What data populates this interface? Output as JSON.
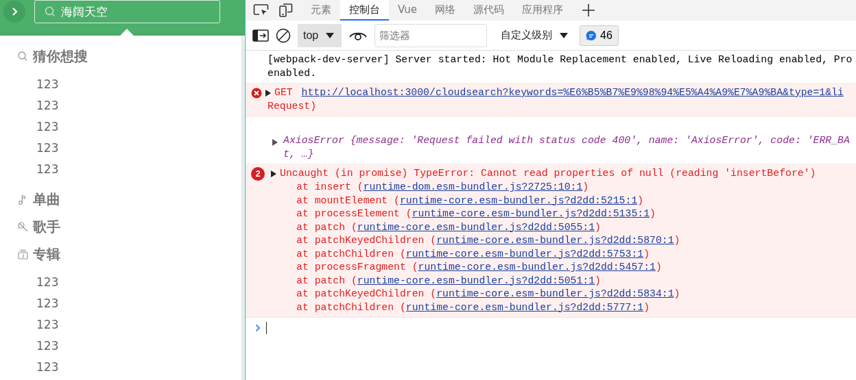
{
  "app": {
    "search": {
      "value": "海阔天空"
    },
    "suggestions": [
      {
        "kind": "search",
        "title": "猜你想搜",
        "items": [
          "123",
          "123",
          "123",
          "123",
          "123"
        ]
      },
      {
        "kind": "song",
        "title": "单曲"
      },
      {
        "kind": "singer",
        "title": "歌手"
      },
      {
        "kind": "album",
        "title": "专辑",
        "items": [
          "123",
          "123",
          "123",
          "123",
          "123"
        ]
      }
    ]
  },
  "devtools": {
    "tabs": [
      {
        "label": "元素",
        "selected": false
      },
      {
        "label": "控制台",
        "selected": true
      },
      {
        "label": "Vue",
        "selected": false
      },
      {
        "label": "网络",
        "selected": false
      },
      {
        "label": "源代码",
        "selected": false
      },
      {
        "label": "应用程序",
        "selected": false
      }
    ],
    "context": "top",
    "filter": {
      "placeholder": "筛选器"
    },
    "levels": "自定义级别",
    "message_count": "46",
    "messages": [
      {
        "kind": "info",
        "lines": [
          "[webpack-dev-server] Server started: Hot Module Replacement enabled, Live Reloading enabled, Pro",
          "enabled."
        ]
      },
      {
        "kind": "network-error",
        "expanded": false,
        "method": "GET ",
        "url": "http://localhost:3000/cloudsearch?keywords=%E6%B5%B7%E9%98%94%E5%A4%A9%E7%A9%BA&type=1&li",
        "continuation": "Request)"
      },
      {
        "kind": "object",
        "expanded": false,
        "lines": [
          "AxiosError {message: 'Request failed with status code 400', name: 'AxiosError', code: 'ERR_BA",
          "t, …}"
        ]
      },
      {
        "kind": "exception",
        "expanded": false,
        "count": "2",
        "text": "Uncaught (in promise) TypeError: Cannot read properties of null (reading 'insertBefore')",
        "frames": [
          {
            "prefix": "at insert (",
            "link": "runtime-dom.esm-bundler.js?2725:10:1",
            "suffix": ")"
          },
          {
            "prefix": "at mountElement (",
            "link": "runtime-core.esm-bundler.js?d2dd:5215:1",
            "suffix": ")"
          },
          {
            "prefix": "at processElement (",
            "link": "runtime-core.esm-bundler.js?d2dd:5135:1",
            "suffix": ")"
          },
          {
            "prefix": "at patch (",
            "link": "runtime-core.esm-bundler.js?d2dd:5055:1",
            "suffix": ")"
          },
          {
            "prefix": "at patchKeyedChildren (",
            "link": "runtime-core.esm-bundler.js?d2dd:5870:1",
            "suffix": ")"
          },
          {
            "prefix": "at patchChildren (",
            "link": "runtime-core.esm-bundler.js?d2dd:5753:1",
            "suffix": ")"
          },
          {
            "prefix": "at processFragment (",
            "link": "runtime-core.esm-bundler.js?d2dd:5457:1",
            "suffix": ")"
          },
          {
            "prefix": "at patch (",
            "link": "runtime-core.esm-bundler.js?d2dd:5051:1",
            "suffix": ")"
          },
          {
            "prefix": "at patchKeyedChildren (",
            "link": "runtime-core.esm-bundler.js?d2dd:5834:1",
            "suffix": ")"
          },
          {
            "prefix": "at patchChildren (",
            "link": "runtime-core.esm-bundler.js?d2dd:5777:1",
            "suffix": ")"
          }
        ]
      }
    ]
  }
}
